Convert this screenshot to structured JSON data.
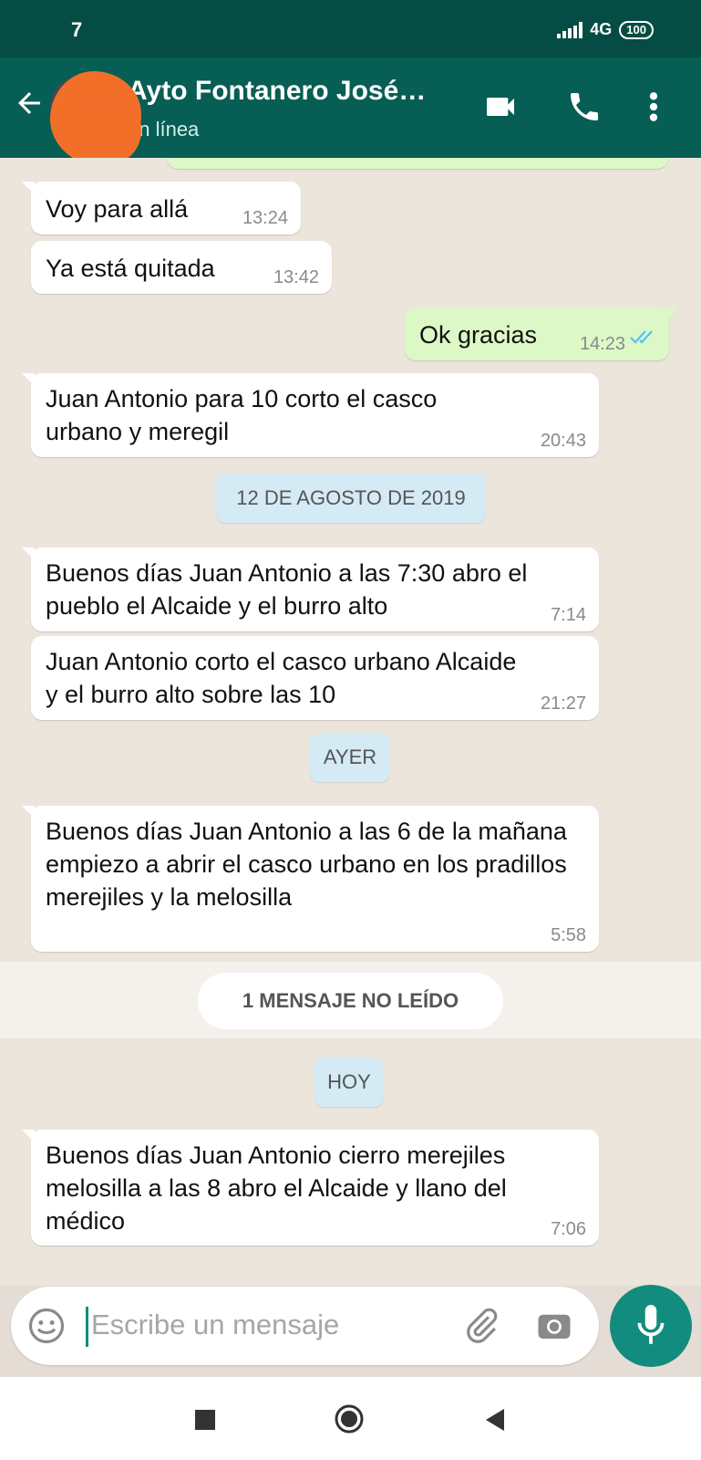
{
  "status_bar": {
    "time": "7",
    "network": "4G",
    "battery": "100"
  },
  "header": {
    "contact_name": "Ayto Fontanero José…",
    "status": "en línea"
  },
  "messages": [
    {
      "text": "Voy para allá",
      "time": "13:24"
    },
    {
      "text": "Ya está quitada",
      "time": "13:42"
    },
    {
      "text": "Ok gracias",
      "time": "14:23"
    },
    {
      "text": "Juan Antonio para 10 corto el casco urbano y meregil",
      "time": "20:43"
    },
    {
      "text": "Buenos días Juan Antonio a las 7:30 abro el pueblo el Alcaide y el burro alto",
      "time": "7:14"
    },
    {
      "text": "Juan Antonio corto el casco urbano Alcaide y el burro alto sobre las 10",
      "time": "21:27"
    },
    {
      "text": "Buenos días Juan Antonio a las 6 de la mañana empiezo a abrir el casco urbano en los pradillos merejiles y la melosilla",
      "time": "5:58"
    },
    {
      "text": "Buenos días Juan Antonio cierro merejiles melosilla a las 8 abro el Alcaide y llano del médico",
      "time": "7:06"
    }
  ],
  "date_separators": [
    "12 DE AGOSTO DE 2019",
    "AYER",
    "HOY"
  ],
  "unread_label": "1 MENSAJE NO LEÍDO",
  "composer": {
    "placeholder": "Escribe un mensaje"
  },
  "colors": {
    "header": "#075e54",
    "outgoing": "#dcf8c6",
    "accent": "#128c7e",
    "read_ticks": "#4fc3f7"
  }
}
